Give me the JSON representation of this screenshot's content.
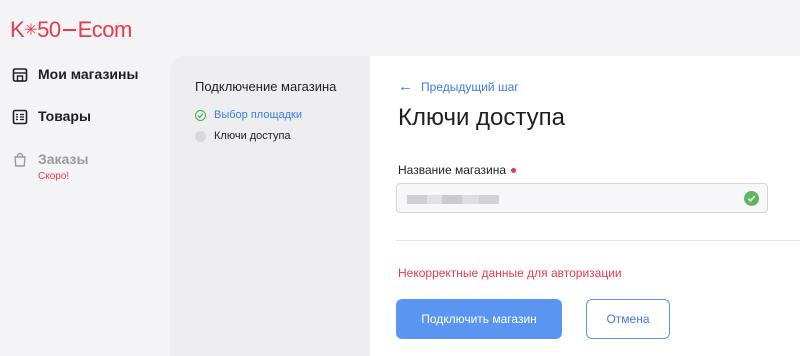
{
  "app": {
    "logo": {
      "part1": "K",
      "star": "✳",
      "part2": "50",
      "part3": "Ecom"
    }
  },
  "nav": {
    "items": [
      {
        "label": "Мои магазины",
        "icon": "store-icon"
      },
      {
        "label": "Товары",
        "icon": "list-icon"
      },
      {
        "label": "Заказы",
        "icon": "bag-icon",
        "badge": "Скоро!"
      }
    ]
  },
  "steps": {
    "title": "Подключение магазина",
    "items": [
      {
        "label": "Выбор площадки",
        "state": "done"
      },
      {
        "label": "Ключи доступа",
        "state": "pending"
      }
    ]
  },
  "form": {
    "back_label": "Предыдущий шаг",
    "title": "Ключи доступа",
    "store_name_label": "Название магазина",
    "error": "Некорректные данные для авторизации",
    "submit_label": "Подключить магазин",
    "cancel_label": "Отмена"
  },
  "colors": {
    "brand": "#e8384f",
    "accent": "#5b95f2",
    "link": "#3d7be0",
    "success": "#5cb85c"
  }
}
